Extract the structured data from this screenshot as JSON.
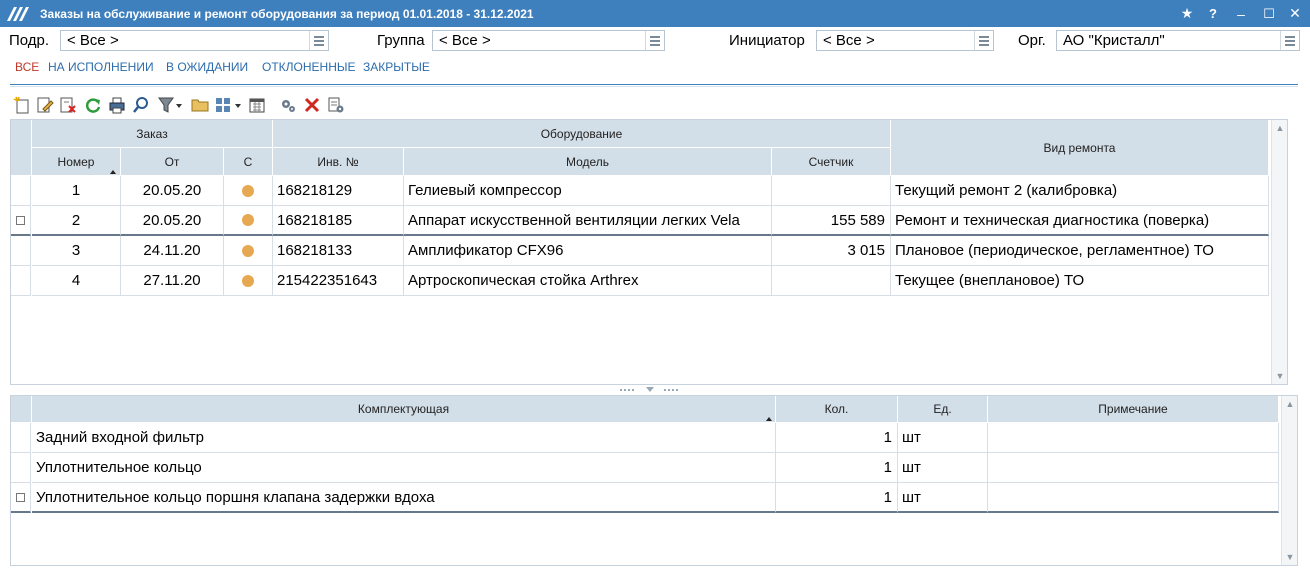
{
  "window": {
    "title": "Заказы на обслуживание и ремонт оборудования за период 01.01.2018 - 31.12.2021",
    "buttons": {
      "star": "★",
      "help": "?",
      "minimize": "‒",
      "maximize": "☐",
      "close": "✕"
    }
  },
  "filters": {
    "podr_label": "Подр.",
    "podr_value": "< Все >",
    "group_label": "Группа",
    "group_value": "< Все >",
    "initiator_label": "Инициатор",
    "initiator_value": "< Все >",
    "org_label": "Орг.",
    "org_value": "АО \"Кристалл\""
  },
  "tabs": [
    "ВСЕ",
    "НА ИСПОЛНЕНИИ",
    "В ОЖИДАНИИ",
    "ОТКЛОНЕННЫЕ",
    "ЗАКРЫТЫЕ"
  ],
  "active_tab": "ВСЕ",
  "toolbar_icons": [
    "new-icon",
    "edit-icon",
    "delete-doc-icon",
    "refresh-icon",
    "print-icon",
    "search-icon",
    "filter-icon",
    "folder-icon",
    "layout-icon",
    "calendar-icon",
    "settings-icon",
    "cancel-icon",
    "properties-icon"
  ],
  "orders": {
    "group_headers": {
      "order": "Заказ",
      "equipment": "Оборудование",
      "repair_type": "Вид ремонта"
    },
    "columns": {
      "number": "Номер",
      "from": "От",
      "status": "С",
      "inv": "Инв. №",
      "model": "Модель",
      "counter": "Счетчик"
    },
    "rows": [
      {
        "number": "1",
        "from": "20.05.20",
        "inv": "168218129",
        "model": "Гелиевый компрессор",
        "counter": "",
        "repair": "Текущий ремонт 2 (калибровка)"
      },
      {
        "number": "2",
        "from": "20.05.20",
        "inv": "168218185",
        "model": "Аппарат искусственной вентиляции легких Vela",
        "counter": "155 589",
        "repair": "Ремонт и техническая диагностика (поверка)"
      },
      {
        "number": "3",
        "from": "24.11.20",
        "inv": "168218133",
        "model": "Амплификатор CFX96",
        "counter": "3 015",
        "repair": "Плановое (периодическое, регламентное) ТО"
      },
      {
        "number": "4",
        "from": "27.11.20",
        "inv": "215422351643",
        "model": "Артроскопическая стойка Arthrex",
        "counter": "",
        "repair": "Текущее (внеплановое) ТО"
      }
    ],
    "status_color": "#e6a851"
  },
  "parts": {
    "columns": {
      "part": "Комплектующая",
      "qty": "Кол.",
      "unit": "Ед.",
      "note": "Примечание"
    },
    "rows": [
      {
        "part": "Задний входной фильтр",
        "qty": "1",
        "unit": "шт",
        "note": ""
      },
      {
        "part": "Уплотнительное кольцо",
        "qty": "1",
        "unit": "шт",
        "note": ""
      },
      {
        "part": "Уплотнительное кольцо поршня клапана задержки вдоха",
        "qty": "1",
        "unit": "шт",
        "note": ""
      }
    ]
  },
  "colors": {
    "accent": "#3e7fbd",
    "header_bg": "#d3dfe8",
    "active_tab": "#c0392b"
  }
}
